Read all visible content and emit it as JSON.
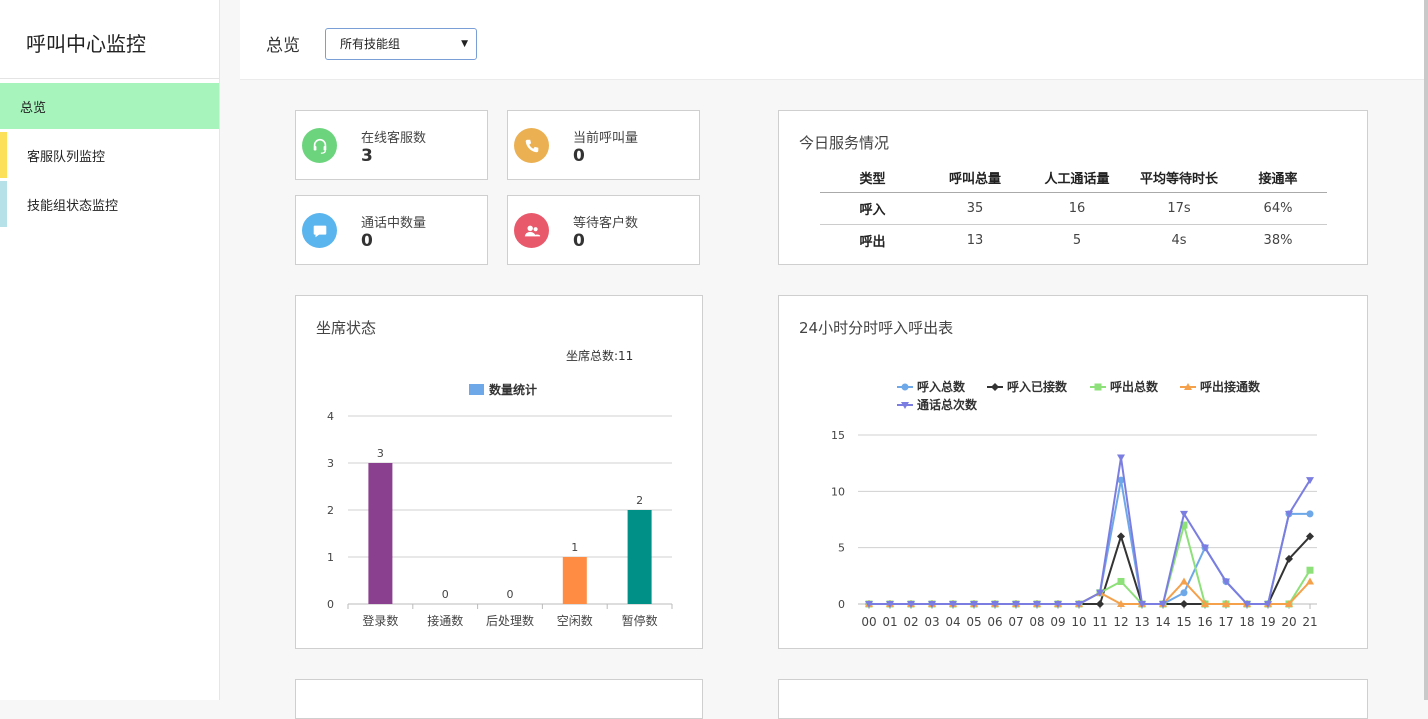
{
  "sidebar": {
    "title": "呼叫中心监控",
    "items": [
      {
        "label": "总览",
        "active": true
      },
      {
        "label": "客服队列监控",
        "accent": "#fce05a"
      },
      {
        "label": "技能组状态监控",
        "accent": "#b7e1e8"
      }
    ]
  },
  "header": {
    "title": "总览",
    "skill_group_select": "所有技能组"
  },
  "stats": [
    {
      "label": "在线客服数",
      "value": "3",
      "icon": "headset-icon",
      "color": "#6dd47e"
    },
    {
      "label": "当前呼叫量",
      "value": "0",
      "icon": "phone-icon",
      "color": "#ebb052"
    },
    {
      "label": "通话中数量",
      "value": "0",
      "icon": "chat-bubble-icon",
      "color": "#5ab4ee"
    },
    {
      "label": "等待客户数",
      "value": "0",
      "icon": "users-icon",
      "color": "#e9596c"
    }
  ],
  "service_today": {
    "title": "今日服务情况",
    "columns": [
      "类型",
      "呼叫总量",
      "人工通话量",
      "平均等待时长",
      "接通率"
    ],
    "rows": [
      [
        "呼入",
        "35",
        "16",
        "17s",
        "64%"
      ],
      [
        "呼出",
        "13",
        "5",
        "4s",
        "38%"
      ]
    ]
  },
  "seat_status": {
    "title": "坐席状态",
    "total_label": "坐席总数:11"
  },
  "hourly": {
    "title": "24小时分时呼入呼出表"
  },
  "chart_data": [
    {
      "type": "bar",
      "legend": [
        "数量统计"
      ],
      "categories": [
        "登录数",
        "接通数",
        "后处理数",
        "空闲数",
        "暂停数"
      ],
      "values": [
        3,
        0,
        0,
        1,
        2
      ],
      "colors": [
        "#8b3f8f",
        "#5ab4ee",
        "#6dd47e",
        "#ff8c42",
        "#009088"
      ],
      "ylim": [
        0,
        4
      ],
      "yticks": [
        0,
        1,
        2,
        3,
        4
      ],
      "grid": true
    },
    {
      "type": "line",
      "categories": [
        "00",
        "01",
        "02",
        "03",
        "04",
        "05",
        "06",
        "07",
        "08",
        "09",
        "10",
        "11",
        "12",
        "13",
        "14",
        "15",
        "16",
        "17",
        "18",
        "19",
        "20",
        "21"
      ],
      "ylim": [
        0,
        15
      ],
      "yticks": [
        0,
        5,
        10,
        15
      ],
      "grid": true,
      "legend_position": "top",
      "series": [
        {
          "name": "呼入总数",
          "color": "#6fa8e8",
          "marker": "circle",
          "values": [
            0,
            0,
            0,
            0,
            0,
            0,
            0,
            0,
            0,
            0,
            0,
            1,
            11,
            0,
            0,
            1,
            5,
            2,
            0,
            0,
            8,
            8
          ]
        },
        {
          "name": "呼入已接数",
          "color": "#333333",
          "marker": "diamond",
          "values": [
            0,
            0,
            0,
            0,
            0,
            0,
            0,
            0,
            0,
            0,
            0,
            0,
            6,
            0,
            0,
            0,
            0,
            0,
            0,
            0,
            4,
            6
          ]
        },
        {
          "name": "呼出总数",
          "color": "#8ee07a",
          "marker": "square",
          "values": [
            0,
            0,
            0,
            0,
            0,
            0,
            0,
            0,
            0,
            0,
            0,
            1,
            2,
            0,
            0,
            7,
            0,
            0,
            0,
            0,
            0,
            3
          ]
        },
        {
          "name": "呼出接通数",
          "color": "#f5a04a",
          "marker": "triangle",
          "values": [
            0,
            0,
            0,
            0,
            0,
            0,
            0,
            0,
            0,
            0,
            0,
            1,
            0,
            0,
            0,
            2,
            0,
            0,
            0,
            0,
            0,
            2
          ]
        },
        {
          "name": "通话总次数",
          "color": "#7b7ee0",
          "marker": "triangle-down",
          "values": [
            0,
            0,
            0,
            0,
            0,
            0,
            0,
            0,
            0,
            0,
            0,
            1,
            13,
            0,
            0,
            8,
            5,
            2,
            0,
            0,
            8,
            11
          ]
        }
      ]
    }
  ]
}
